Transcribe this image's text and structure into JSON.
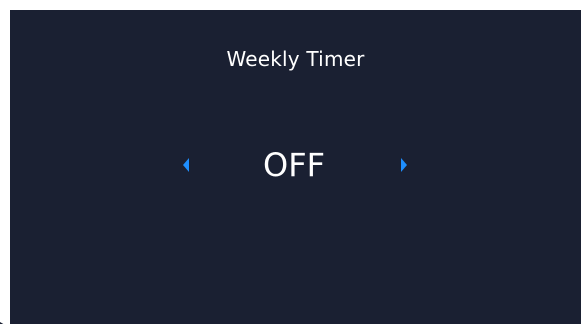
{
  "screen": {
    "title": "Weekly Timer",
    "value": "OFF"
  },
  "icons": {
    "prev": "caret-left-icon",
    "next": "caret-right-icon"
  },
  "colors": {
    "background": "#1a2032",
    "text": "#ffffff",
    "accent": "#1e8fff"
  }
}
